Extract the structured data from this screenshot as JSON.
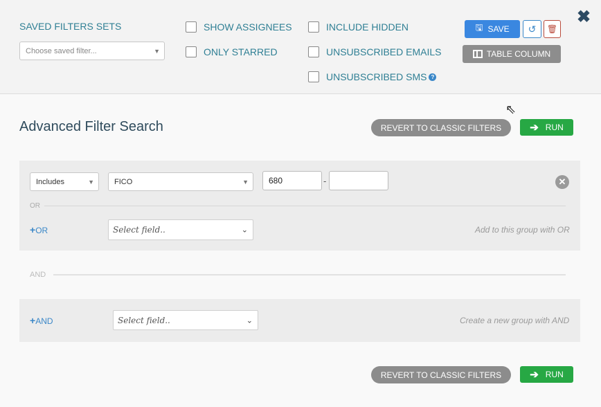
{
  "saved_filters": {
    "label": "SAVED FILTERS SETS",
    "placeholder": "Choose saved filter..."
  },
  "checkboxes": {
    "show_assignees": "SHOW ASSIGNEES",
    "only_starred": "ONLY STARRED",
    "include_hidden": "INCLUDE HIDDEN",
    "unsubscribed_emails": "UNSUBSCRIBED EMAILS",
    "unsubscribed_sms": "UNSUBSCRIBED SMS"
  },
  "toolbar": {
    "save_label": "SAVE",
    "table_column_label": "TABLE COLUMN"
  },
  "main": {
    "title": "Advanced Filter Search",
    "revert_label": "REVERT TO CLASSIC FILTERS",
    "run_label": "RUN"
  },
  "condition": {
    "operator": "Includes",
    "field": "FICO",
    "min_value": "680",
    "max_value": "",
    "range_separator": "-"
  },
  "group1": {
    "or_separator": "OR",
    "add_or_label": "OR",
    "field_placeholder": "Select field..",
    "hint": "Add to this group with OR"
  },
  "and_separator": "AND",
  "group2": {
    "add_and_label": "AND",
    "field_placeholder": "Select field..",
    "hint": "Create a new group with AND"
  },
  "colors": {
    "accent_blue": "#3a87e0",
    "run_green": "#27a844",
    "revert_gray": "#8c8c8c",
    "label_teal": "#2f7f94"
  }
}
